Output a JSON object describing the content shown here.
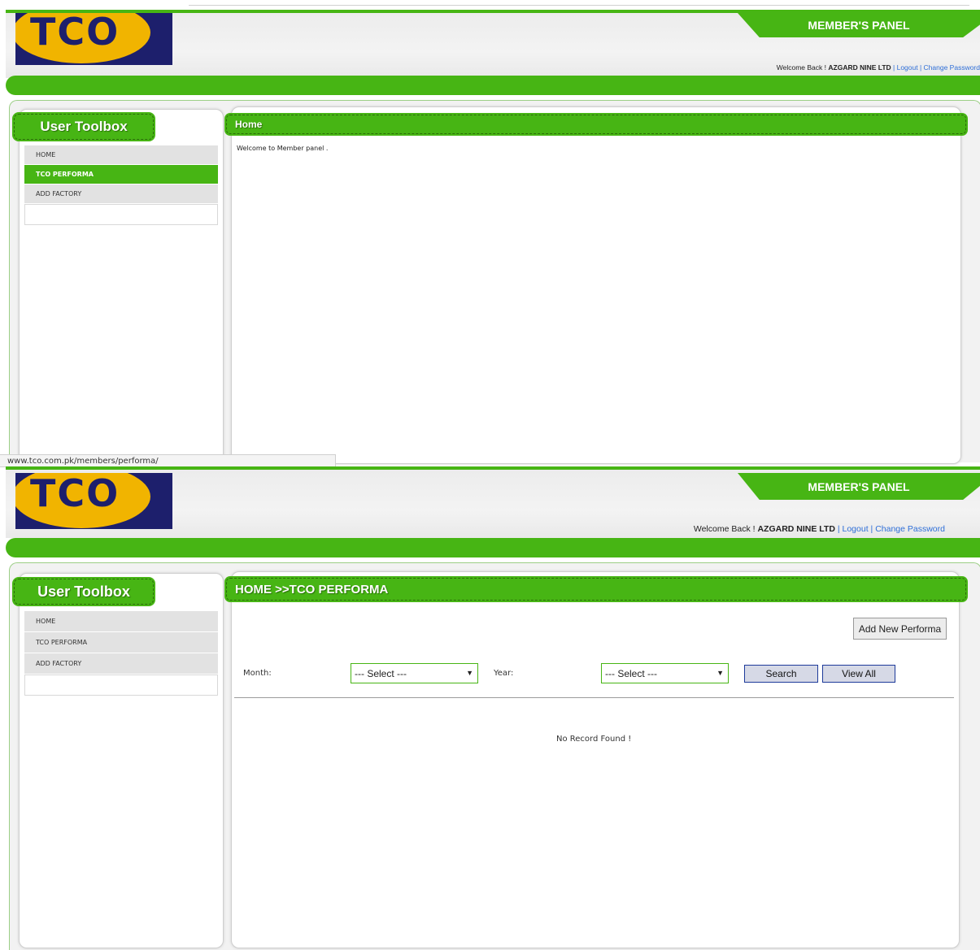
{
  "colors": {
    "accent": "#47b514",
    "link": "#2f6fd8",
    "logo_yellow": "#f1b400",
    "logo_navy": "#1d1f6c"
  },
  "screen1": {
    "logo_text": "TCO",
    "panel_label": "MEMBER'S PANEL",
    "welcome": {
      "prefix": "Welcome Back ! ",
      "user": "AZGARD NINE LTD",
      "sep1": " | ",
      "logout": "Logout",
      "sep2": " | ",
      "change_password": "Change Password"
    },
    "sidebar_title": "User Toolbox",
    "menu": [
      {
        "label": "HOME",
        "active": false
      },
      {
        "label": "TCO PERFORMA",
        "active": true
      },
      {
        "label": "ADD FACTORY",
        "active": false
      }
    ],
    "main_title": "Home",
    "main_text": "Welcome to Member panel .",
    "status_url": "www.tco.com.pk/members/performa/"
  },
  "screen2": {
    "logo_text": "TCO",
    "panel_label": "MEMBER'S PANEL",
    "welcome": {
      "prefix": "Welcome Back ! ",
      "user": "AZGARD NINE LTD",
      "sep1": " | ",
      "logout": "Logout",
      "sep2": " | ",
      "change_password": "Change Password"
    },
    "sidebar_title": "User Toolbox",
    "menu": [
      {
        "label": "HOME",
        "active": false
      },
      {
        "label": "TCO PERFORMA",
        "active": false
      },
      {
        "label": "ADD FACTORY",
        "active": false
      }
    ],
    "main_title": "HOME >>TCO PERFORMA",
    "add_button": "Add New Performa",
    "month_label": "Month:",
    "month_value": "--- Select ---",
    "year_label": "Year:",
    "year_value": "--- Select ---",
    "search_button": "Search",
    "view_all_button": "View All",
    "empty_message": "No Record Found !"
  }
}
